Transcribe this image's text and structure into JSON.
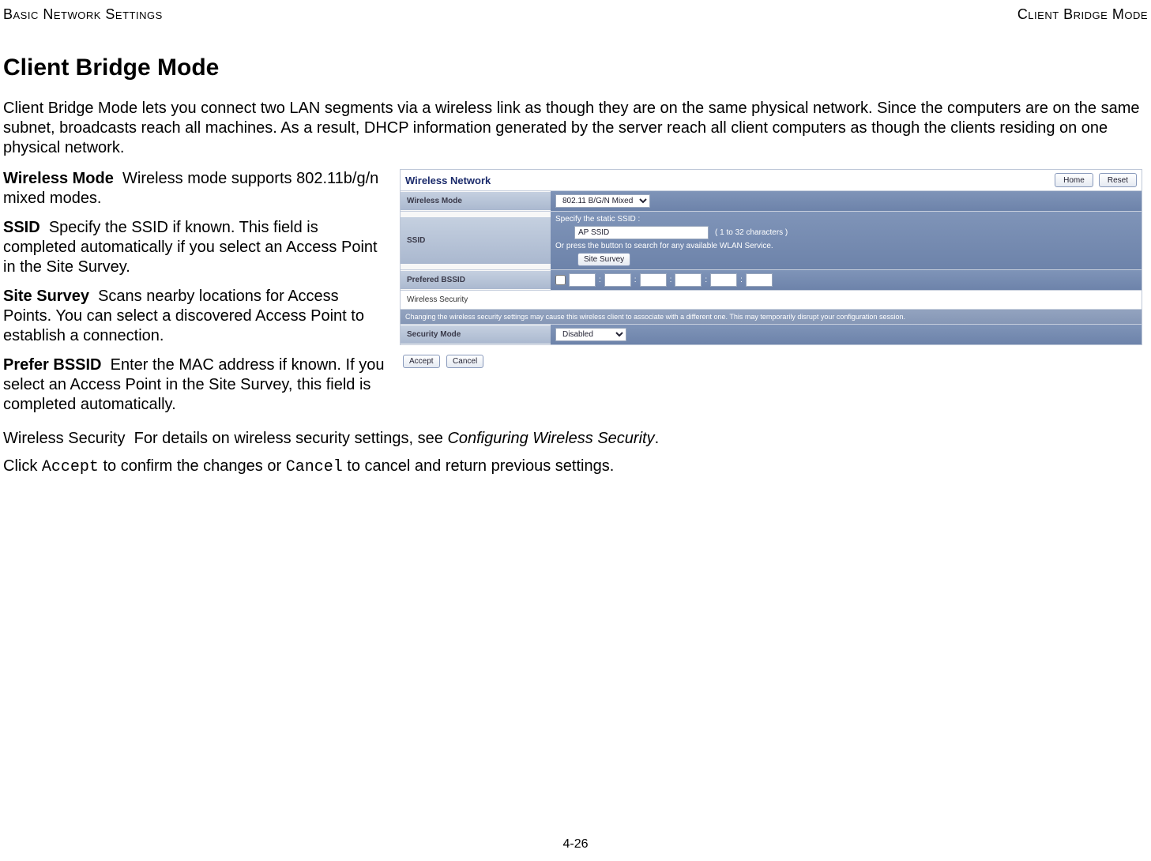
{
  "header": {
    "left": "Basic Network Settings",
    "right": "Client Bridge Mode"
  },
  "title": "Client Bridge Mode",
  "intro": "Client Bridge Mode lets you connect two LAN segments via a wireless link as though they are on the same physical network. Since the computers are on the same subnet, broadcasts reach all machines. As a result, DHCP information generated by the server reach all client computers as though the clients residing on one physical network.",
  "definitions": [
    {
      "term": "Wireless Mode",
      "desc": "Wireless mode supports 802.11b/g/n mixed modes."
    },
    {
      "term": "SSID",
      "desc": "Specify the SSID if known. This field is completed automatically if you select an Access Point in the Site Survey."
    },
    {
      "term": "Site Survey",
      "desc": "Scans nearby locations for Access Points. You can select a discovered Access Point to establish a connection."
    },
    {
      "term": "Prefer BSSID",
      "desc": "Enter the MAC address if known. If you select an Access Point in the Site Survey, this field is completed automatically."
    }
  ],
  "wireless_security": {
    "term": "Wireless Security",
    "desc_prefix": "For details on wireless security settings, see ",
    "desc_link": "Configuring Wireless Security",
    "desc_suffix": "."
  },
  "confirm_line": {
    "pre": "Click ",
    "accept": "Accept",
    "mid": " to confirm the changes or ",
    "cancel": "Cancel",
    "post": " to cancel and return previous settings."
  },
  "screenshot": {
    "title": "Wireless Network",
    "home": "Home",
    "reset": "Reset",
    "rows": {
      "wireless_mode_label": "Wireless Mode",
      "wireless_mode_value": "802.11 B/G/N Mixed",
      "ssid_label": "SSID",
      "ssid_specify": "Specify the static SSID  :",
      "ssid_input": "AP SSID",
      "ssid_chars": "( 1 to 32 characters )",
      "ssid_press": "Or press the button to search for any available WLAN Service.",
      "site_survey_btn": "Site Survey",
      "prefered_label": "Prefered BSSID",
      "wireless_security_hdr": "Wireless Security",
      "security_note": "Changing the wireless security settings may cause this wireless client to associate with a different one. This may temporarily disrupt your configuration session.",
      "security_mode_label": "Security Mode",
      "security_mode_value": "Disabled"
    },
    "footer": {
      "accept": "Accept",
      "cancel": "Cancel"
    }
  },
  "page_number": "4-26"
}
